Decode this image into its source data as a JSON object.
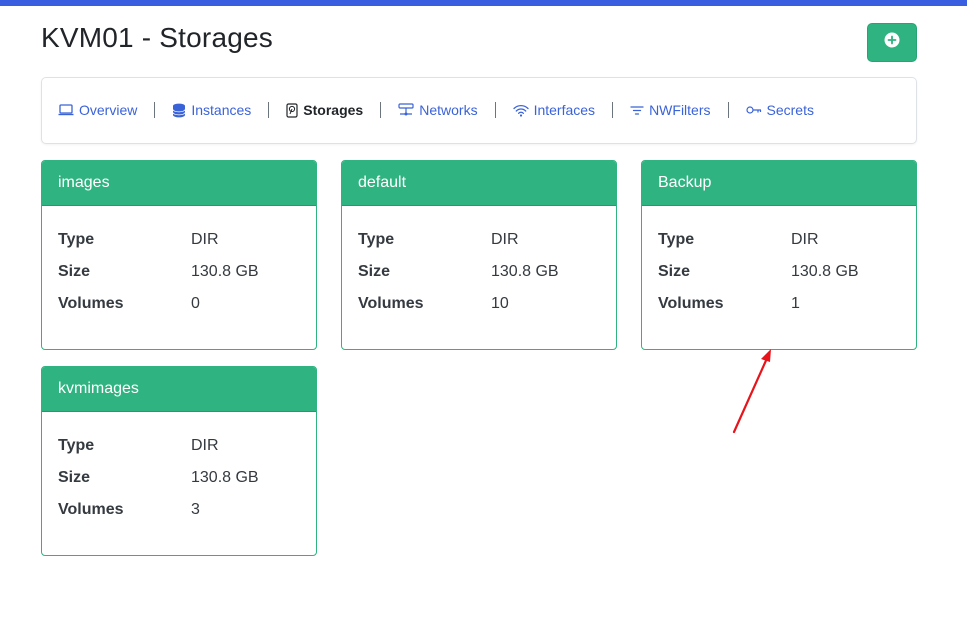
{
  "page": {
    "title": "KVM01 - Storages"
  },
  "nav": {
    "items": [
      {
        "label": "Overview",
        "icon": "laptop-icon",
        "active": false
      },
      {
        "label": "Instances",
        "icon": "database-icon",
        "active": false
      },
      {
        "label": "Storages",
        "icon": "hdd-icon",
        "active": true
      },
      {
        "label": "Networks",
        "icon": "network-icon",
        "active": false
      },
      {
        "label": "Interfaces",
        "icon": "wifi-icon",
        "active": false
      },
      {
        "label": "NWFilters",
        "icon": "filter-icon",
        "active": false
      },
      {
        "label": "Secrets",
        "icon": "key-icon",
        "active": false
      }
    ]
  },
  "labels": {
    "type": "Type",
    "size": "Size",
    "volumes": "Volumes"
  },
  "storages": [
    {
      "name": "images",
      "type": "DIR",
      "size": "130.8 GB",
      "volumes": "0"
    },
    {
      "name": "default",
      "type": "DIR",
      "size": "130.8 GB",
      "volumes": "10"
    },
    {
      "name": "Backup",
      "type": "DIR",
      "size": "130.8 GB",
      "volumes": "1"
    },
    {
      "name": "kvmimages",
      "type": "DIR",
      "size": "130.8 GB",
      "volumes": "3"
    }
  ],
  "colors": {
    "accent": "#2fb380",
    "topbar": "#3a5ee0",
    "link": "#3b63d8",
    "annotation": "#e8141b"
  },
  "add_button": {
    "icon": "plus-circle-icon"
  }
}
